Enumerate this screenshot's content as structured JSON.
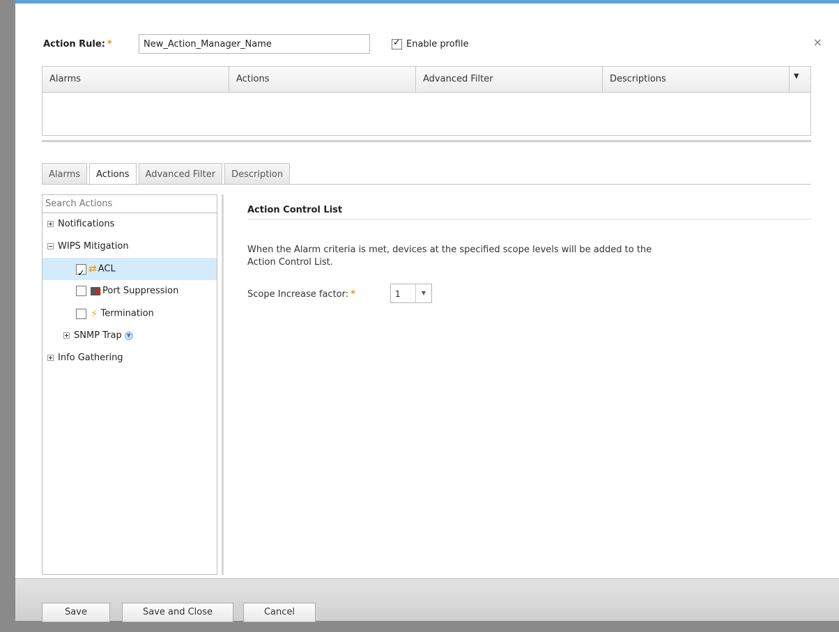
{
  "header": {
    "rule_label": "Action Rule:",
    "required_marker": "*",
    "rule_name_value": "New_Action_Manager_Name",
    "enable_profile_label": "Enable profile",
    "enable_profile_checked": true,
    "close_glyph": "×"
  },
  "grid": {
    "columns": [
      "Alarms",
      "Actions",
      "Advanced Filter",
      "Descriptions"
    ],
    "rows": []
  },
  "tabs": [
    {
      "label": "Alarms",
      "active": false
    },
    {
      "label": "Actions",
      "active": true
    },
    {
      "label": "Advanced Filter",
      "active": false
    },
    {
      "label": "Description",
      "active": false
    }
  ],
  "tree": {
    "search_placeholder": "Search Actions",
    "items": {
      "notifications": "Notifications",
      "wips_mitigation": "WIPS Mitigation",
      "acl": "ACL",
      "port_suppression": "Port Suppression",
      "termination": "Termination",
      "snmp_trap": "SNMP Trap",
      "info_gathering": "Info Gathering"
    },
    "acl_checked": true,
    "port_suppression_checked": false,
    "termination_checked": false
  },
  "detail": {
    "title": "Action Control List",
    "description": "When the Alarm criteria is met, devices at the specified scope levels will be added to the Action Control List.",
    "scope_label": "Scope Increase factor:",
    "scope_value": "1"
  },
  "footer": {
    "save": "Save",
    "save_and_close": "Save and Close",
    "cancel": "Cancel"
  },
  "colors": {
    "accent_top": "#5aa3dc",
    "required": "#f28c1c",
    "selection": "#d4ebfb"
  }
}
